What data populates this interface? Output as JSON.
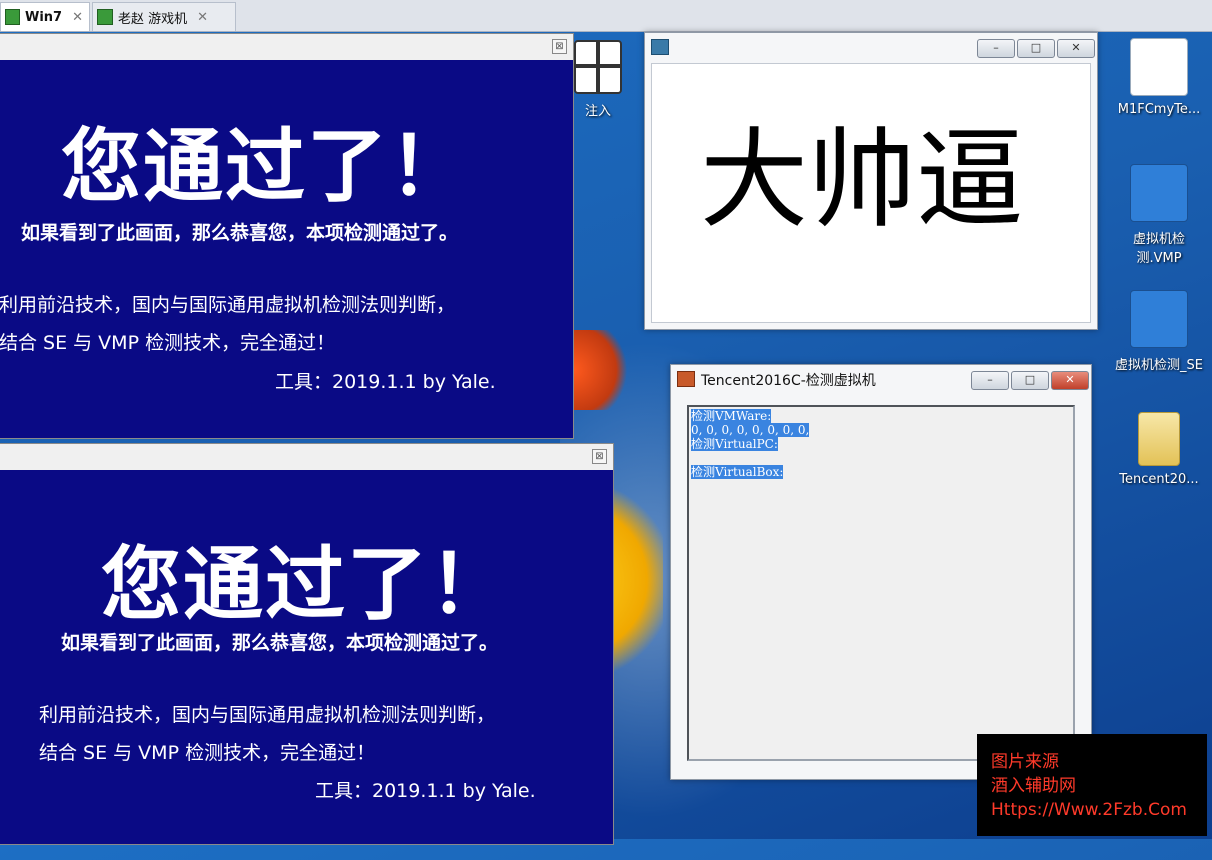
{
  "tabs": [
    {
      "label": "Win7",
      "close": "✕"
    },
    {
      "label": "老赵 游戏机",
      "close": "✕"
    }
  ],
  "popup_top": {
    "headline": "您通过了！",
    "subtitle": "如果看到了此画面，那么恭喜您，本项检测通过了。",
    "line1": "利用前沿技术，国内与国际通用虚拟机检测法则判断，",
    "line2": "结合 SE 与 VMP 检测技术，完全通过！",
    "tool": "工具：2019.1.1  by Yale.",
    "close": "⊠"
  },
  "popup_bottom": {
    "headline": "您通过了！",
    "subtitle": "如果看到了此画面，那么恭喜您，本项检测通过了。",
    "line1": "利用前沿技术，国内与国际通用虚拟机检测法则判断，",
    "line2": "结合 SE 与 VMP 检测技术，完全通过！",
    "tool": "工具：2019.1.1  by Yale.",
    "close": "⊠"
  },
  "inject_icon": {
    "label": "注入"
  },
  "dashuaibi_window": {
    "text": "大帅逼"
  },
  "tencent_window": {
    "title": "Tencent2016C-检测虚拟机",
    "lines": [
      "检测VMWare:",
      "0, 0, 0, 0, 0, 0, 0, 0,",
      "检测VirtualPC:",
      "",
      "检测VirtualBox:"
    ]
  },
  "desktop_icons": [
    {
      "label": "M1FCmyTe..."
    },
    {
      "label": "虚拟机检测.VMP"
    },
    {
      "label": "虚拟机检测_SE"
    },
    {
      "label": "Tencent20..."
    }
  ],
  "watermark": {
    "line1": "图片来源",
    "line2": "酒入辅助网",
    "line3": "Https://Www.2Fzb.Com"
  },
  "colors": {
    "popup_blue": "#0a0a85",
    "desktop_blue": "#1a5fb0",
    "highlight": "#3a84e0"
  }
}
